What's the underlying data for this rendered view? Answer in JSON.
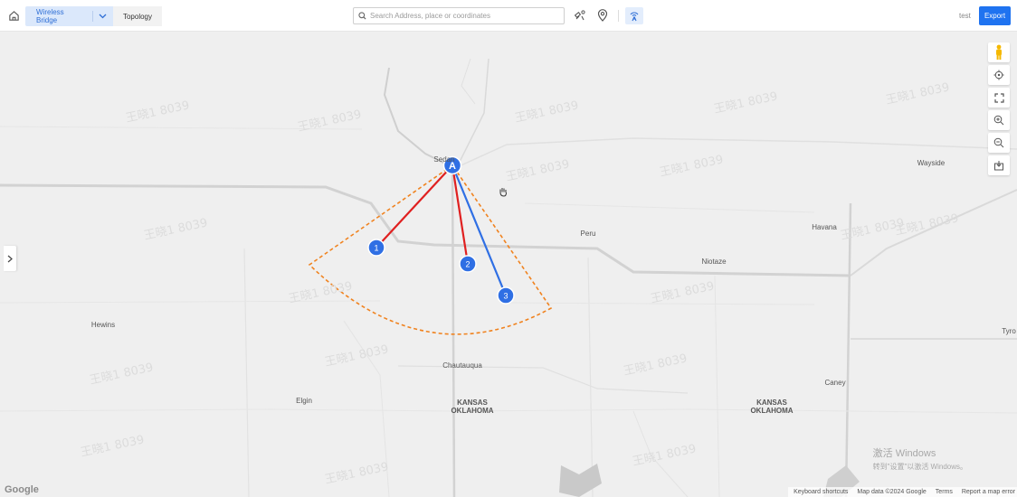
{
  "header": {
    "tabs": [
      {
        "label": "Wireless Bridge",
        "active": true
      },
      {
        "label": "Topology",
        "active": false
      }
    ],
    "search_placeholder": "Search Address, place or coordinates",
    "search_value": "",
    "username": "test",
    "export_label": "Export"
  },
  "map": {
    "places": [
      {
        "name": "Sedan"
      },
      {
        "name": "Peru"
      },
      {
        "name": "Havana"
      },
      {
        "name": "Niotaze"
      },
      {
        "name": "Wayside"
      },
      {
        "name": "Hewins"
      },
      {
        "name": "Chautauqua"
      },
      {
        "name": "Elgin"
      },
      {
        "name": "Caney"
      },
      {
        "name": "Tyro"
      }
    ],
    "states": [
      {
        "line1": "KANSAS",
        "line2": "OKLAHOMA"
      },
      {
        "line1": "KANSAS",
        "line2": "OKLAHOMA"
      }
    ],
    "access_point": {
      "label": "A",
      "color": "#2f6fe4"
    },
    "clients": [
      {
        "label": "1",
        "link_color": "#e02020"
      },
      {
        "label": "2",
        "link_color": "#e02020"
      },
      {
        "label": "3",
        "link_color": "#2f6fe4"
      }
    ],
    "coverage_sector_color": "#f0821e",
    "watermark_text": "王晓1 8039",
    "google_logo": "Google",
    "attribution": [
      "Keyboard shortcuts",
      "Map data ©2024 Google",
      "Terms",
      "Report a map error"
    ]
  },
  "overlay": {
    "activation_title": "激活 Windows",
    "activation_sub": "转到\"设置\"以激活 Windows。"
  }
}
